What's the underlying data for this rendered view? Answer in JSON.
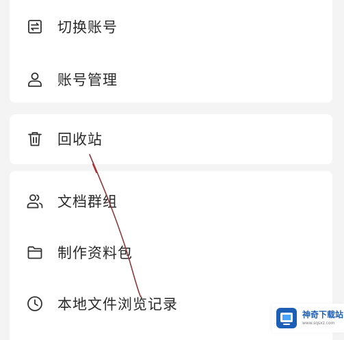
{
  "menu": {
    "group1": [
      {
        "label": "切换账号",
        "icon": "switch-account-icon"
      },
      {
        "label": "账号管理",
        "icon": "user-icon"
      }
    ],
    "group2": [
      {
        "label": "回收站",
        "icon": "trash-icon"
      }
    ],
    "group3": [
      {
        "label": "文档群组",
        "icon": "group-icon"
      },
      {
        "label": "制作资料包",
        "icon": "folder-icon"
      },
      {
        "label": "本地文件浏览记录",
        "icon": "clock-icon"
      }
    ]
  },
  "watermark": {
    "title": "神奇下载站",
    "url": "www.sqsxz.com",
    "color": "#1d5fb6"
  },
  "colors": {
    "background": "#f4f4f5",
    "card": "#ffffff",
    "text": "#2a2a2a",
    "icon": "#333333",
    "stroke": "#8a3a3a"
  }
}
